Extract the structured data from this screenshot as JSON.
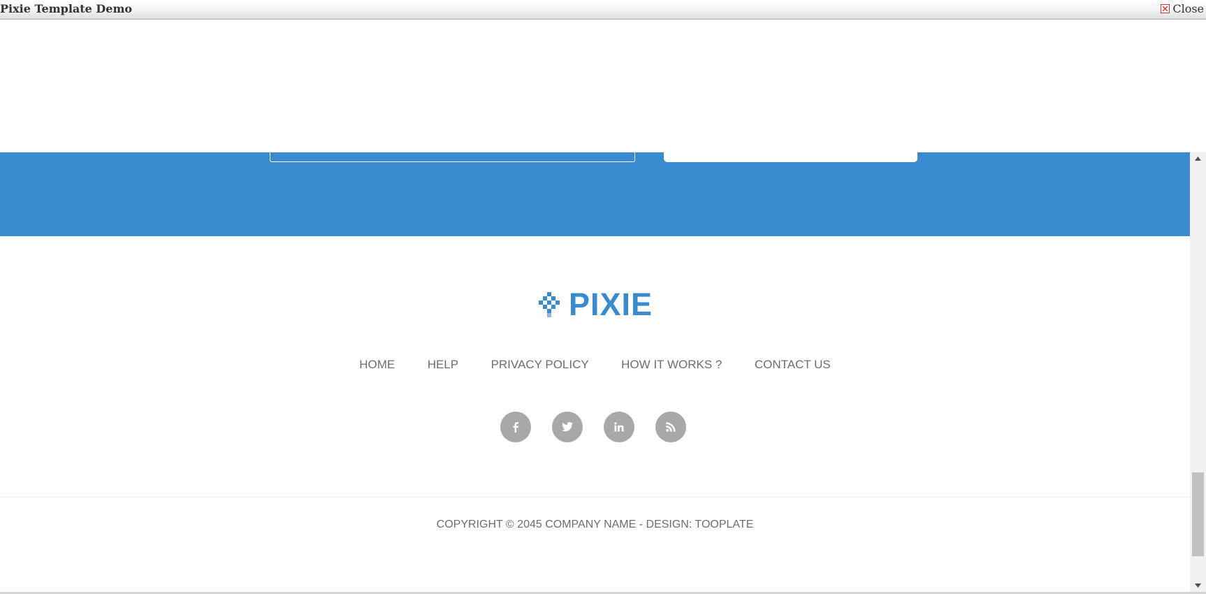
{
  "window": {
    "title": "Pixie Template Demo",
    "close_label": "Close"
  },
  "colors": {
    "accent": "#3a8bce",
    "text": "#6d6d6d",
    "social_bg": "#a8a8a8"
  },
  "logo": {
    "text": "PIXIE",
    "icon": "pixel-diamond-icon"
  },
  "nav": {
    "items": [
      {
        "label": "HOME"
      },
      {
        "label": "HELP"
      },
      {
        "label": "PRIVACY POLICY"
      },
      {
        "label": "HOW IT WORKS ?"
      },
      {
        "label": "CONTACT US"
      }
    ]
  },
  "social": [
    {
      "name": "facebook-icon",
      "glyph": "f"
    },
    {
      "name": "twitter-icon",
      "glyph": "t"
    },
    {
      "name": "linkedin-icon",
      "glyph": "in"
    },
    {
      "name": "rss-icon",
      "glyph": "rss"
    }
  ],
  "footer": {
    "copyright": "COPYRIGHT © 2045 COMPANY NAME - DESIGN: TOOPLATE"
  }
}
